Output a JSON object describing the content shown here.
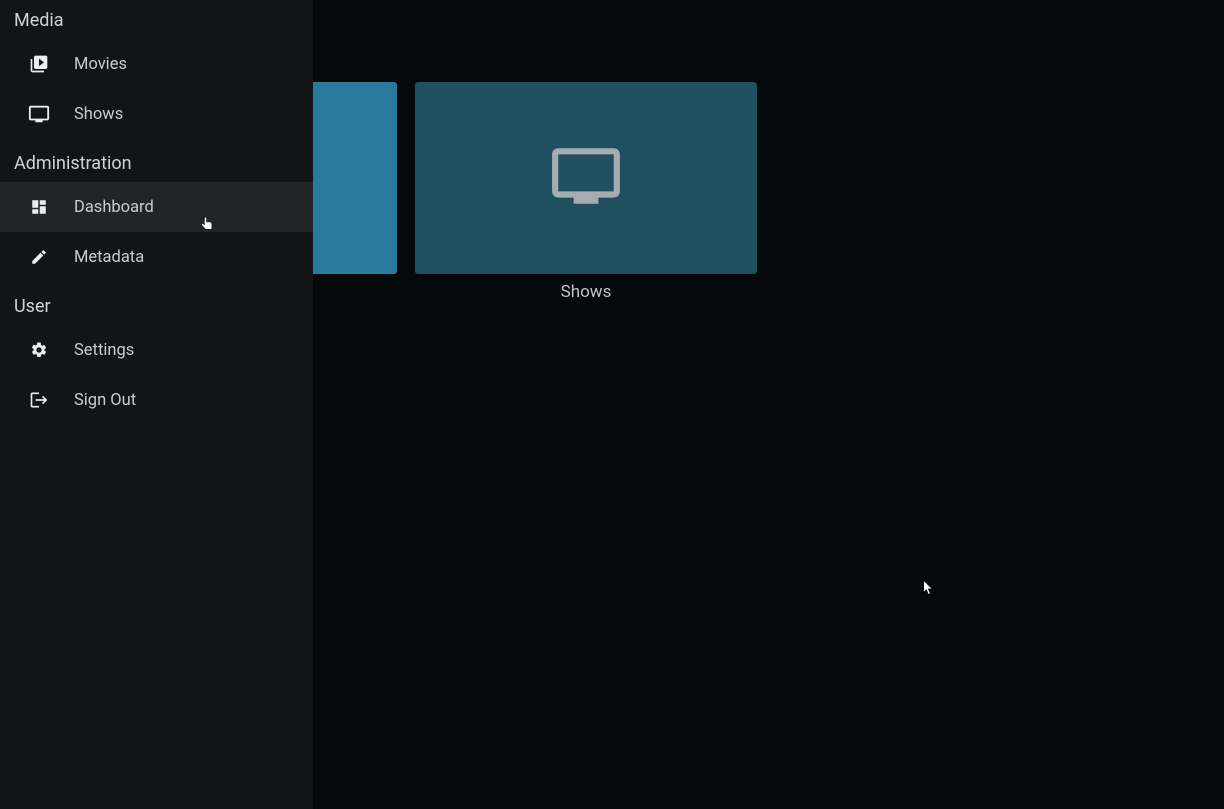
{
  "sidebar": {
    "sections": [
      {
        "header": "Media",
        "items": [
          {
            "label": "Movies",
            "icon": "video-library-icon"
          },
          {
            "label": "Shows",
            "icon": "tv-icon"
          }
        ]
      },
      {
        "header": "Administration",
        "items": [
          {
            "label": "Dashboard",
            "icon": "dashboard-icon",
            "active": true
          },
          {
            "label": "Metadata",
            "icon": "edit-icon"
          }
        ]
      },
      {
        "header": "User",
        "items": [
          {
            "label": "Settings",
            "icon": "gear-icon"
          },
          {
            "label": "Sign Out",
            "icon": "signout-icon"
          }
        ]
      }
    ]
  },
  "main": {
    "cards": [
      {
        "label": "",
        "partial": true
      },
      {
        "label": "Shows",
        "icon": "tv-large-icon"
      }
    ]
  }
}
